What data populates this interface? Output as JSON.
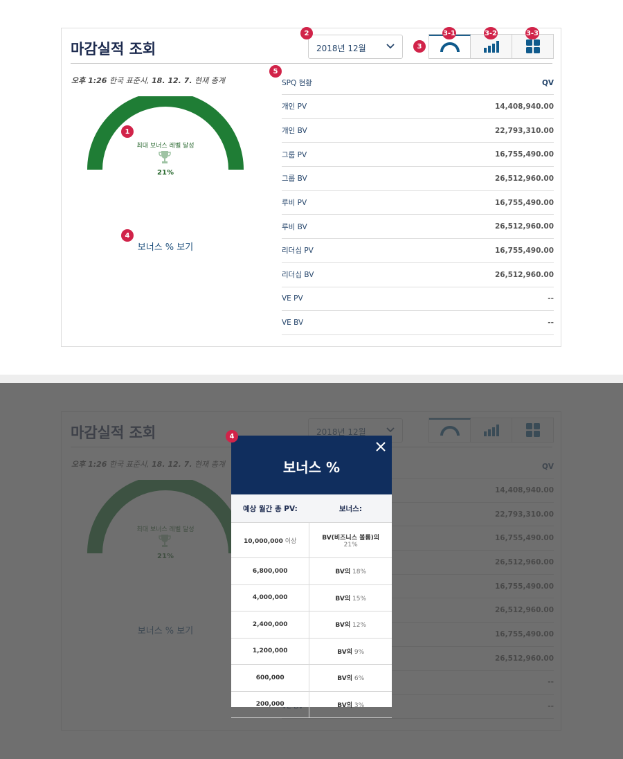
{
  "title": "마감실적 조회",
  "period_select": {
    "value": "2018년 12월"
  },
  "view_toggle": [
    "gauge-view-icon",
    "bar-chart-icon",
    "grid-view-icon"
  ],
  "timestamp": {
    "time": "오후 1:26",
    "zone": " 한국 표준시, ",
    "date": "18. 12. 7.",
    "suffix": " 현재 총계"
  },
  "gauge": {
    "label": "최대 보너스 레벨 달성",
    "percent": "21%",
    "level": 1.0,
    "color": "#1f7d35"
  },
  "bonus_link": "보너스 % 보기",
  "spq": {
    "header_label": "SPQ 현황",
    "header_value": "QV",
    "rows": [
      {
        "label": "개인 PV",
        "value": "14,408,940.00"
      },
      {
        "label": "개인 BV",
        "value": "22,793,310.00"
      },
      {
        "label": "그룹 PV",
        "value": "16,755,490.00"
      },
      {
        "label": "그룹 BV",
        "value": "26,512,960.00"
      },
      {
        "label": "루비 PV",
        "value": "16,755,490.00"
      },
      {
        "label": "루비 BV",
        "value": "26,512,960.00"
      },
      {
        "label": "리더십 PV",
        "value": "16,755,490.00"
      },
      {
        "label": "리더십 BV",
        "value": "26,512,960.00"
      },
      {
        "label": "VE PV",
        "value": "--"
      },
      {
        "label": "VE BV",
        "value": "--"
      }
    ]
  },
  "annotations": [
    "1",
    "2",
    "3",
    "3-1",
    "3-2",
    "3-3",
    "4",
    "5"
  ],
  "modal": {
    "title": "보너스 %",
    "col1": "예상 월간 총 PV:",
    "col2": "보너스:",
    "first_row": {
      "pv": "10,000,000",
      "pv_suffix": " 이상",
      "bonus_main": "BV(비즈니스 볼륨)의",
      "bonus_pct": "21%"
    },
    "rows": [
      {
        "pv": "6,800,000",
        "bv": "BV의",
        "pct": " 18%"
      },
      {
        "pv": "4,000,000",
        "bv": "BV의",
        "pct": " 15%"
      },
      {
        "pv": "2,400,000",
        "bv": "BV의",
        "pct": " 12%"
      },
      {
        "pv": "1,200,000",
        "bv": "BV의",
        "pct": " 9%"
      },
      {
        "pv": "600,000",
        "bv": "BV의",
        "pct": " 6%"
      },
      {
        "pv": "200,000",
        "bv": "BV의",
        "pct": " 3%"
      }
    ]
  },
  "colors": {
    "brand_navy": "#102e5e",
    "badge_red": "#d12349",
    "gauge_green": "#1f7d35",
    "link_blue": "#1d4f7c"
  }
}
